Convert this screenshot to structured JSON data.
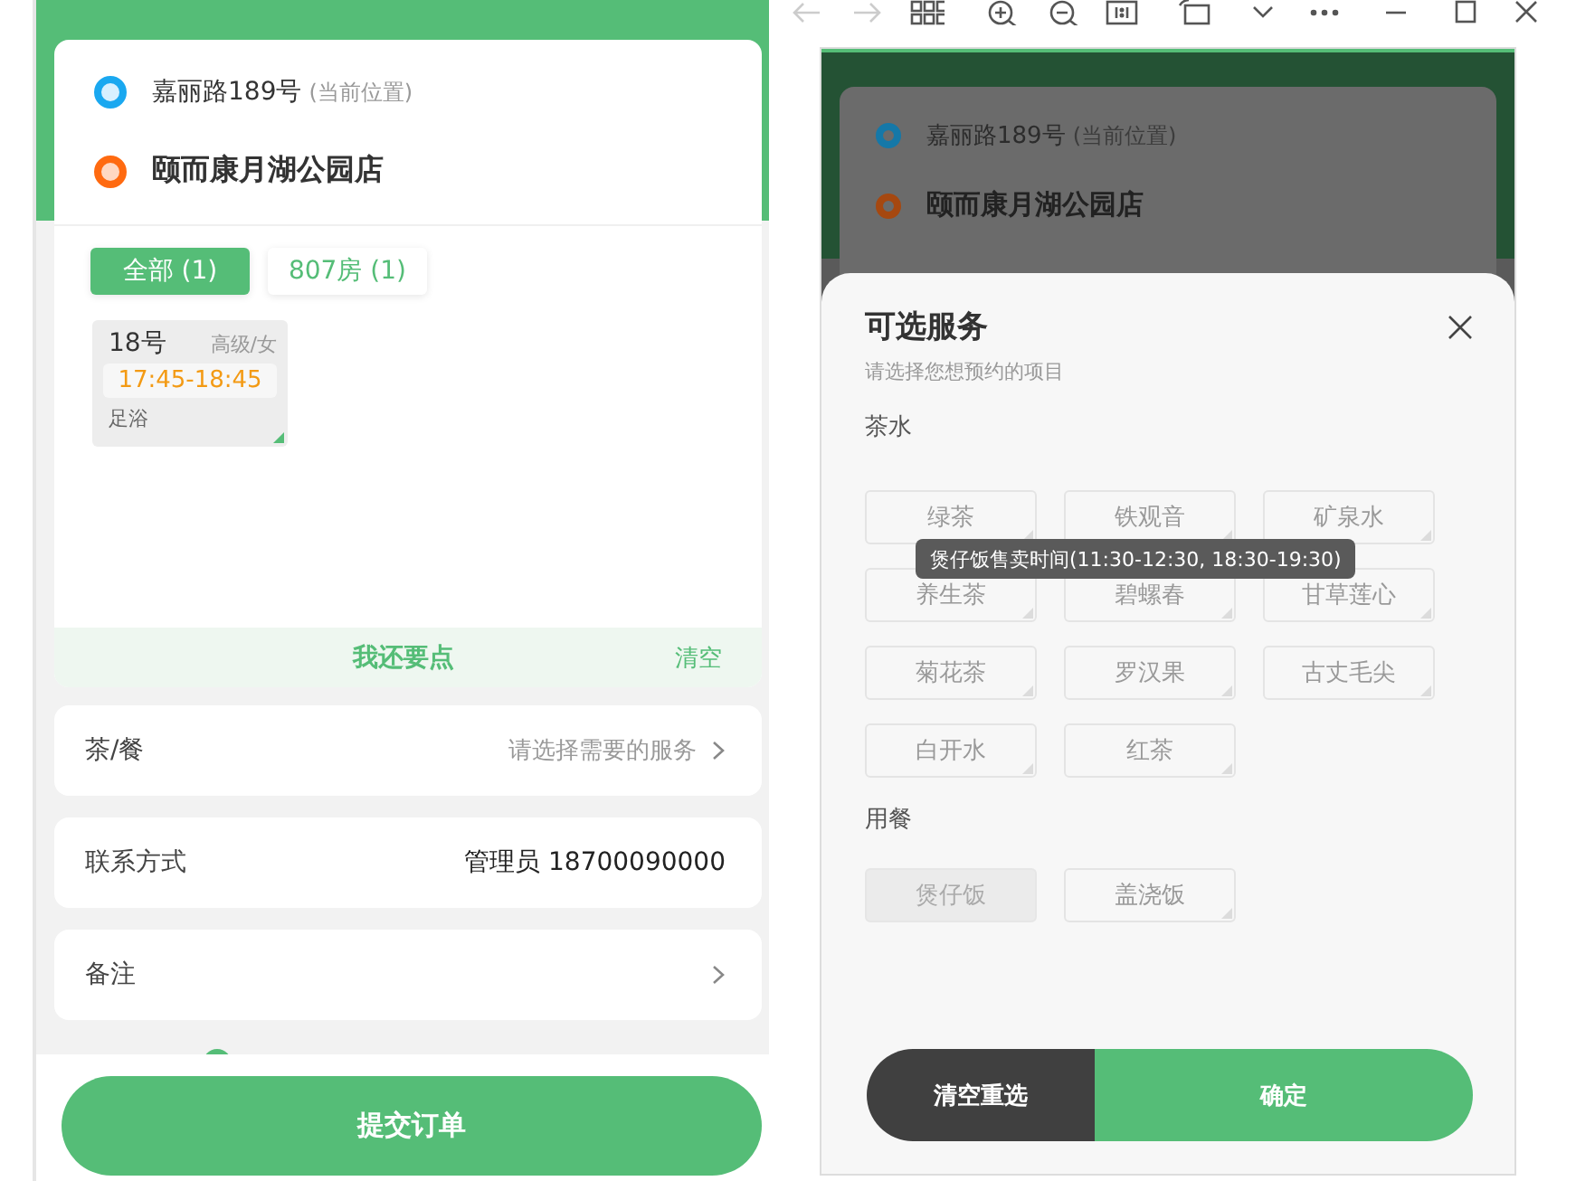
{
  "order": {
    "origin": "嘉丽路189号",
    "origin_note": "(当前位置)",
    "destination": "颐而康月湖公园店",
    "filters": [
      {
        "label": "全部 (1)",
        "selected": true
      },
      {
        "label": "807房 (1)",
        "selected": false
      }
    ],
    "booking": {
      "number": "18号",
      "grade": "高级/女",
      "time": "17:45-18:45",
      "service": "足浴"
    },
    "add_more": "我还要点",
    "clear": "清空",
    "rows": [
      {
        "label": "茶/餐",
        "value": "请选择需要的服务",
        "kind": "placeholder",
        "chevron": true
      },
      {
        "label": "联系方式",
        "value": "管理员 18700090000",
        "kind": "value",
        "chevron": false
      },
      {
        "label": "备注",
        "chevron": true
      }
    ],
    "submit": "提交订单"
  },
  "preview": {
    "origin": "嘉丽路189号",
    "origin_note": "(当前位置)",
    "destination": "颐而康月湖公园店",
    "sheet": {
      "title": "可选服务",
      "subtitle": "请选择您想预约的项目",
      "groups": [
        {
          "name": "茶水",
          "items": [
            {
              "label": "绿茶",
              "disabled": false
            },
            {
              "label": "铁观音",
              "disabled": false
            },
            {
              "label": "矿泉水",
              "disabled": false
            },
            {
              "label": "养生茶",
              "disabled": false
            },
            {
              "label": "碧螺春",
              "disabled": false
            },
            {
              "label": "甘草莲心",
              "disabled": false
            },
            {
              "label": "菊花茶",
              "disabled": false
            },
            {
              "label": "罗汉果",
              "disabled": false
            },
            {
              "label": "古丈毛尖",
              "disabled": false
            },
            {
              "label": "白开水",
              "disabled": false
            },
            {
              "label": "红茶",
              "disabled": false
            }
          ]
        },
        {
          "name": "用餐",
          "items": [
            {
              "label": "煲仔饭",
              "disabled": true
            },
            {
              "label": "盖浇饭",
              "disabled": false
            }
          ]
        }
      ],
      "tooltip": "煲仔饭售卖时间(11:30-12:30, 18:30-19:30)",
      "buttons": [
        {
          "label": "清空重选",
          "kind": "reset"
        },
        {
          "label": "确定",
          "kind": "confirm"
        }
      ]
    }
  }
}
